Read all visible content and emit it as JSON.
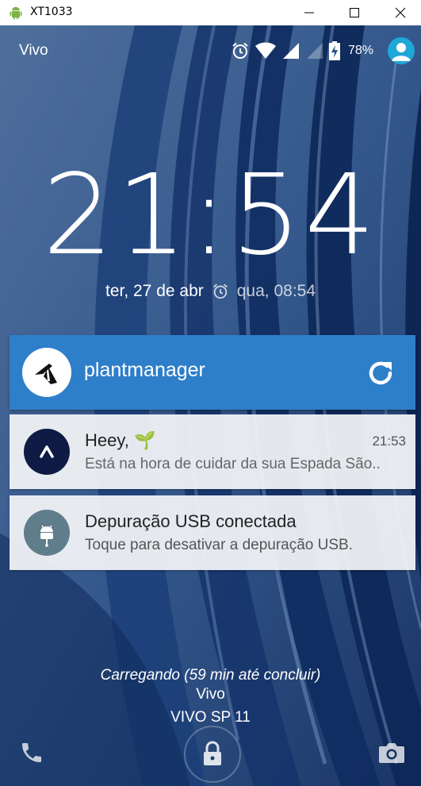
{
  "window": {
    "title": "XT1033",
    "app_icon": "android-icon",
    "controls": [
      "minimize",
      "maximize",
      "close"
    ]
  },
  "statusbar": {
    "carrier": "Vivo",
    "icons": [
      "alarm-icon",
      "wifi-icon",
      "signal-icon",
      "signal-empty-icon",
      "battery-charging-icon"
    ],
    "battery_percent": "78%"
  },
  "lockscreen": {
    "clock_hours": "21",
    "clock_minutes": "54",
    "date": "ter, 27 de abr",
    "next_alarm": "qua, 08:54"
  },
  "app_card": {
    "name": "plantmanager",
    "color": "#2e7fc9"
  },
  "notifications": [
    {
      "title": "Heey, 🌱",
      "time": "21:53",
      "text": "Está na hora de cuidar da sua Espada São..",
      "icon": "expo-icon"
    },
    {
      "title": "Depuração USB conectada",
      "time": "",
      "text": "Toque para desativar a depuração USB.",
      "icon": "android-debug-icon"
    }
  ],
  "bottom": {
    "charging": "Carregando (59 min até concluir)",
    "carrier": "Vivo",
    "network": "VIVO SP 11"
  },
  "colors": {
    "accent": "#2e7fc9",
    "avatar": "#1fa7d8"
  }
}
